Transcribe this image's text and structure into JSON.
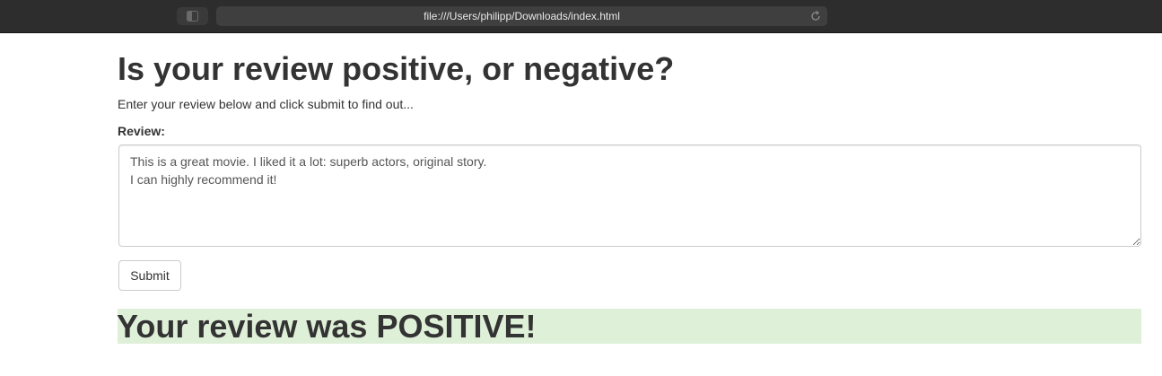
{
  "browser": {
    "url": "file:///Users/philipp/Downloads/index.html",
    "sidebar_icon": "sidebar-icon",
    "reload_icon": "reload-icon"
  },
  "page": {
    "title": "Is your review positive, or negative?",
    "subtitle": "Enter your review below and click submit to find out...",
    "review_label": "Review:",
    "review_value": "This is a great movie. I liked it a lot: superb actors, original story.\nI can highly recommend it!",
    "submit_label": "Submit",
    "result": "Your review was POSITIVE!"
  },
  "colors": {
    "result_background": "#dff0d8",
    "text": "#333333"
  }
}
